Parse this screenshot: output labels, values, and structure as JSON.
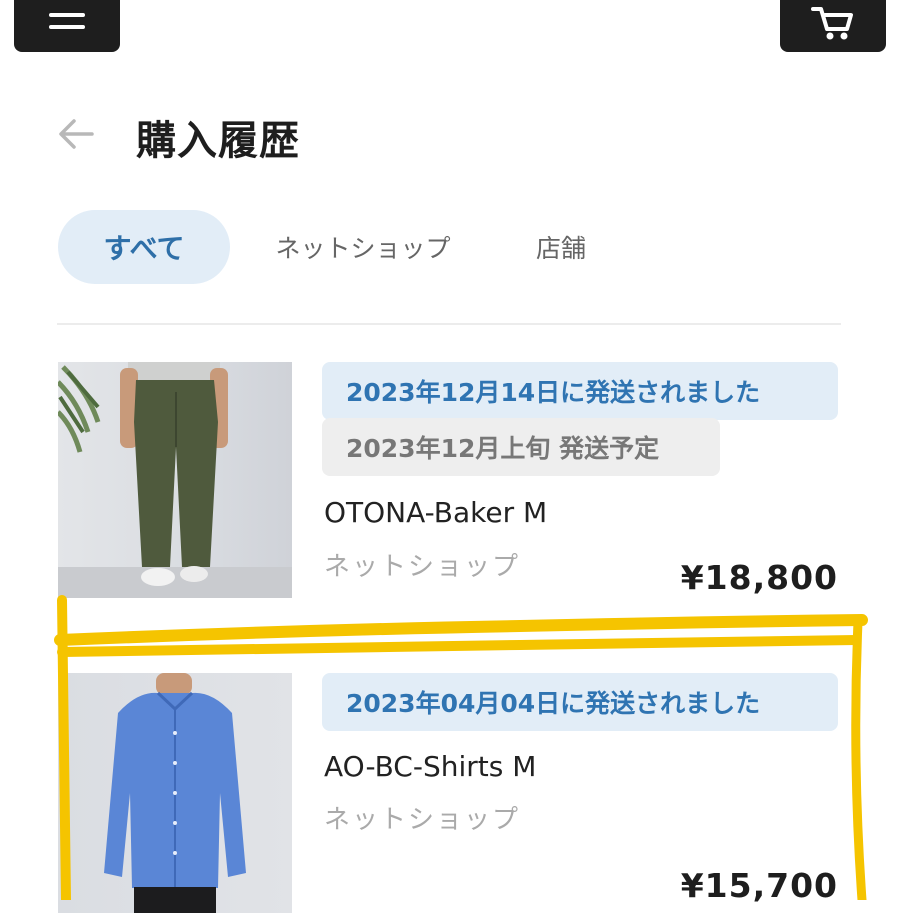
{
  "header": {
    "menu_icon": "hamburger-menu-icon",
    "cart_icon": "shopping-cart-icon",
    "back_icon": "back-arrow-icon",
    "title": "購入履歴"
  },
  "tabs": [
    {
      "label": "すべて",
      "active": true
    },
    {
      "label": "ネットショップ",
      "active": false
    },
    {
      "label": "店舗",
      "active": false
    }
  ],
  "orders": [
    {
      "shipped_status": "2023年12月14日に発送されました",
      "scheduled_status": "2023年12月上旬 発送予定",
      "name": "OTONA-Baker M",
      "shop": "ネットショップ",
      "price": "¥18,800"
    },
    {
      "shipped_status": "2023年04月04日に発送されました",
      "name": "AO-BC-Shirts M",
      "shop": "ネットショップ",
      "price": "¥15,700"
    }
  ],
  "colors": {
    "accent": "#2f74b2",
    "accent_bg": "#e2edf7",
    "dark": "#1e1e1e",
    "highlight_marker": "#f5c400"
  }
}
